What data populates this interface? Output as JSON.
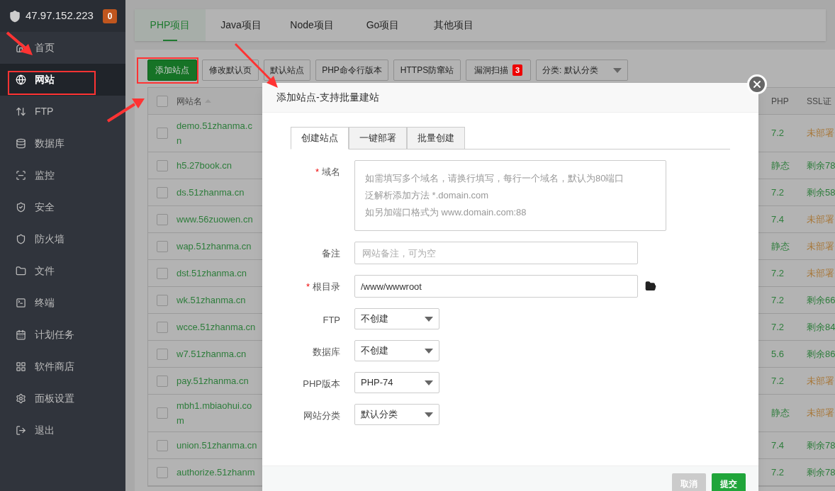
{
  "sidebar": {
    "server": "47.97.152.223",
    "badge": "0",
    "items": [
      {
        "label": "首页",
        "kind": "home",
        "selected": false
      },
      {
        "label": "网站",
        "kind": "globe",
        "selected": true
      },
      {
        "label": "FTP",
        "kind": "ftp",
        "selected": false
      },
      {
        "label": "数据库",
        "kind": "database",
        "selected": false
      },
      {
        "label": "监控",
        "kind": "monitor",
        "selected": false
      },
      {
        "label": "安全",
        "kind": "shield",
        "selected": false
      },
      {
        "label": "防火墙",
        "kind": "firewall",
        "selected": false
      },
      {
        "label": "文件",
        "kind": "folder",
        "selected": false
      },
      {
        "label": "终端",
        "kind": "terminal",
        "selected": false
      },
      {
        "label": "计划任务",
        "kind": "calendar",
        "selected": false
      },
      {
        "label": "软件商店",
        "kind": "grid",
        "selected": false
      },
      {
        "label": "面板设置",
        "kind": "settings",
        "selected": false
      },
      {
        "label": "退出",
        "kind": "logout",
        "selected": false
      }
    ]
  },
  "project_tabs": [
    {
      "label": "PHP项目",
      "selected": true
    },
    {
      "label": "Java项目",
      "selected": false
    },
    {
      "label": "Node项目",
      "selected": false
    },
    {
      "label": "Go项目",
      "selected": false
    },
    {
      "label": "其他项目",
      "selected": false
    }
  ],
  "toolbar": {
    "buttons": [
      {
        "label": "添加站点",
        "kind": "primary"
      },
      {
        "label": "修改默认页",
        "kind": "default"
      },
      {
        "label": "默认站点",
        "kind": "default"
      },
      {
        "label": "PHP命令行版本",
        "kind": "default"
      },
      {
        "label": "HTTPS防窜站",
        "kind": "default"
      },
      {
        "label": "漏洞扫描",
        "kind": "badge",
        "badge": "3"
      }
    ],
    "category": "分类: 默认分类"
  },
  "table": {
    "header_checked": false,
    "columns": [
      "网站名",
      "PHP",
      "SSL证"
    ],
    "rows": [
      {
        "checked": false,
        "name": "demo.51zhanma.cn",
        "php": "7.2",
        "ssl": {
          "text": "未部署",
          "color": "#a8783a"
        }
      },
      {
        "checked": false,
        "name": "h5.27book.cn",
        "php": "静态",
        "ssl": {
          "text": "剩余78",
          "color": "#2e7d3c"
        }
      },
      {
        "checked": false,
        "name": "ds.51zhanma.cn",
        "php": "7.2",
        "ssl": {
          "text": "剩余58",
          "color": "#2e7d3c"
        }
      },
      {
        "checked": false,
        "name": "www.56zuowen.cn",
        "php": "7.4",
        "ssl": {
          "text": "未部署",
          "color": "#a8783a"
        }
      },
      {
        "checked": false,
        "name": "wap.51zhanma.cn",
        "php": "静态",
        "ssl": {
          "text": "未部署",
          "color": "#a8783a"
        }
      },
      {
        "checked": false,
        "name": "dst.51zhanma.cn",
        "php": "7.2",
        "ssl": {
          "text": "未部署",
          "color": "#a8783a"
        }
      },
      {
        "checked": false,
        "name": "wk.51zhanma.cn",
        "php": "7.2",
        "ssl": {
          "text": "剩余66",
          "color": "#2e7d3c"
        }
      },
      {
        "checked": false,
        "name": "wcce.51zhanma.cn",
        "php": "7.2",
        "ssl": {
          "text": "剩余84",
          "color": "#2e7d3c"
        }
      },
      {
        "checked": false,
        "name": "w7.51zhanma.cn",
        "php": "5.6",
        "ssl": {
          "text": "剩余86",
          "color": "#2e7d3c"
        }
      },
      {
        "checked": false,
        "name": "pay.51zhanma.cn",
        "php": "7.2",
        "ssl": {
          "text": "未部署",
          "color": "#a8783a"
        }
      },
      {
        "checked": false,
        "name": "mbh1.mbiaohui.com",
        "php": "静态",
        "ssl": {
          "text": "未部署",
          "color": "#a8783a"
        }
      },
      {
        "checked": false,
        "name": "union.51zhanma.cn",
        "php": "7.4",
        "ssl": {
          "text": "剩余78",
          "color": "#2e7d3c"
        }
      },
      {
        "checked": false,
        "name": "authorize.51zhanm",
        "php": "7.2",
        "ssl": {
          "text": "剩余78",
          "color": "#2e7d3c"
        }
      }
    ]
  },
  "dialog": {
    "title": "添加站点-支持批量建站",
    "tabs": [
      {
        "label": "创建站点",
        "selected": true
      },
      {
        "label": "一键部署",
        "selected": false
      },
      {
        "label": "批量创建",
        "selected": false
      }
    ],
    "fields": [
      {
        "label": "域名",
        "kind": "textarea",
        "required_mark": "*",
        "placeholder": [
          "如需填写多个域名，请换行填写，每行一个域名，默认为80端口",
          "泛解析添加方法 *.domain.com",
          "如另加端口格式为 www.domain.com:88"
        ]
      },
      {
        "label": "备注",
        "kind": "text",
        "placeholder": "网站备注，可为空"
      },
      {
        "label": "根目录",
        "kind": "path",
        "required_mark": "*",
        "value": "/www/wwwroot"
      },
      {
        "label": "FTP",
        "kind": "select",
        "value": "不创建"
      },
      {
        "label": "数据库",
        "kind": "select",
        "value": "不创建"
      },
      {
        "label": "PHP版本",
        "kind": "select",
        "value": "PHP-74"
      },
      {
        "label": "网站分类",
        "kind": "select",
        "value": "默认分类"
      }
    ],
    "buttons": [
      {
        "label": "取消",
        "kind": "cancel"
      },
      {
        "label": "提交",
        "kind": "submit"
      }
    ]
  }
}
